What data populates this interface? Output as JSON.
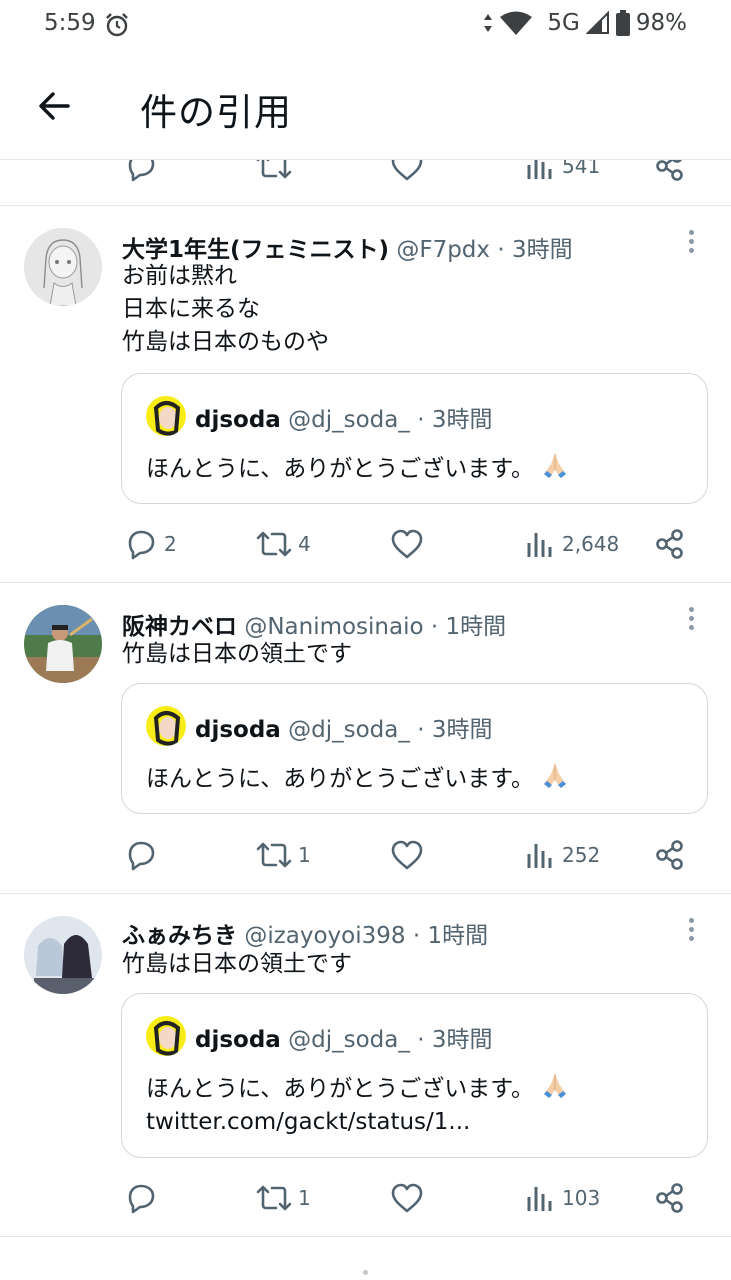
{
  "status_bar": {
    "time": "5:59",
    "network": "5G",
    "battery": "98%"
  },
  "header": {
    "title": "件の引用"
  },
  "partial_row": {
    "views": "541"
  },
  "quote_tweet": {
    "name": "djsoda",
    "handle": "@dj_soda_",
    "time": "· 3時間",
    "text": "ほんとうに、ありがとうございます。",
    "link": "twitter.com/gackt/status/1..."
  },
  "tweets": [
    {
      "name": "大学1年生(フェミニスト)",
      "handle": "@F7pdx",
      "time": "· 3時間",
      "lines": [
        "お前は黙れ",
        "日本に来るな",
        "竹島は日本のものや"
      ],
      "replies": "2",
      "retweets": "4",
      "likes": "",
      "views": "2,648"
    },
    {
      "name": "阪神カベロ",
      "handle": "@Nanimosinaio",
      "time": "· 1時間",
      "lines": [
        "竹島は日本の領土です"
      ],
      "replies": "",
      "retweets": "1",
      "likes": "",
      "views": "252"
    },
    {
      "name": "ふぁみちき",
      "handle": "@izayoyoi398",
      "time": "· 1時間",
      "lines": [
        "竹島は日本の領土です"
      ],
      "replies": "",
      "retweets": "1",
      "likes": "",
      "views": "103"
    }
  ],
  "colors": {
    "text": "#0f1419",
    "secondary": "#536471",
    "border": "#cfd9de",
    "divider": "#e6e9eb"
  }
}
